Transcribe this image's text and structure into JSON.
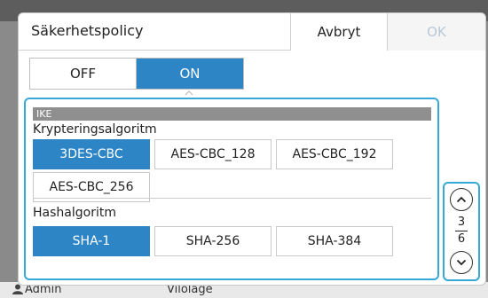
{
  "dialog": {
    "title": "Säkerhetspolicy",
    "cancel_label": "Avbryt",
    "ok_label": "OK"
  },
  "toggle": {
    "off_label": "OFF",
    "on_label": "ON",
    "selected": "ON"
  },
  "ike": {
    "section_label": "IKE",
    "encryption": {
      "label": "Krypteringsalgoritm",
      "options": [
        "3DES-CBC",
        "AES-CBC_128",
        "AES-CBC_192",
        "AES-CBC_256"
      ],
      "selected": "3DES-CBC"
    },
    "hash": {
      "label": "Hashalgoritm",
      "options": [
        "SHA-1",
        "SHA-256",
        "SHA-384"
      ],
      "selected": "SHA-1"
    }
  },
  "pager": {
    "current": "3",
    "total": "6"
  },
  "background": {
    "footer_left": "Admin",
    "footer_mid": "Vilolage"
  },
  "colors": {
    "accent": "#2d85c6",
    "highlight_border": "#38a8d8"
  }
}
